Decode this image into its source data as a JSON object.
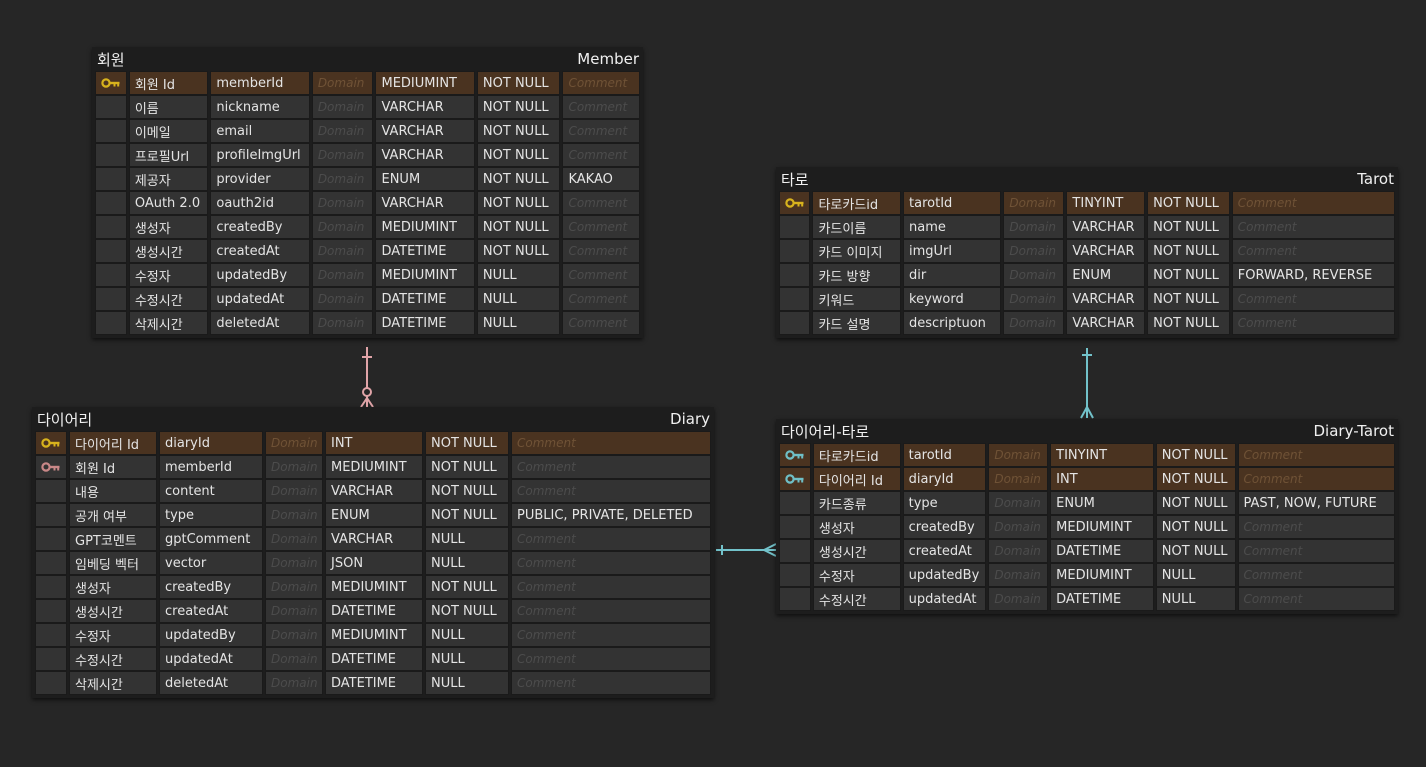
{
  "colors": {
    "pk": "#d8b31d",
    "fk": "#c98888",
    "fk_cyan": "#6fbfc6",
    "rel_pink": "#e0a4a8",
    "rel_cyan": "#72c2ca"
  },
  "placeholders": {
    "domain": "Domain",
    "comment": "Comment"
  },
  "member": {
    "title_ko": "회원",
    "title_en": "Member",
    "rows": [
      {
        "key": "pk",
        "ko": "회원 Id",
        "name": "memberId",
        "type": "MEDIUMINT",
        "nullable": "NOT NULL",
        "comment": ""
      },
      {
        "key": "",
        "ko": "이름",
        "name": "nickname",
        "type": "VARCHAR",
        "nullable": "NOT NULL",
        "comment": ""
      },
      {
        "key": "",
        "ko": "이메일",
        "name": "email",
        "type": "VARCHAR",
        "nullable": "NOT NULL",
        "comment": ""
      },
      {
        "key": "",
        "ko": "프로필Url",
        "name": "profileImgUrl",
        "type": "VARCHAR",
        "nullable": "NOT NULL",
        "comment": ""
      },
      {
        "key": "",
        "ko": "제공자",
        "name": "provider",
        "type": "ENUM",
        "nullable": "NOT NULL",
        "comment": "KAKAO"
      },
      {
        "key": "",
        "ko": "OAuth 2.0",
        "name": "oauth2id",
        "type": "VARCHAR",
        "nullable": "NOT NULL",
        "comment": ""
      },
      {
        "key": "",
        "ko": "생성자",
        "name": "createdBy",
        "type": "MEDIUMINT",
        "nullable": "NOT NULL",
        "comment": ""
      },
      {
        "key": "",
        "ko": "생성시간",
        "name": "createdAt",
        "type": "DATETIME",
        "nullable": "NOT NULL",
        "comment": ""
      },
      {
        "key": "",
        "ko": "수정자",
        "name": "updatedBy",
        "type": "MEDIUMINT",
        "nullable": "NULL",
        "comment": ""
      },
      {
        "key": "",
        "ko": "수정시간",
        "name": "updatedAt",
        "type": "DATETIME",
        "nullable": "NULL",
        "comment": ""
      },
      {
        "key": "",
        "ko": "삭제시간",
        "name": "deletedAt",
        "type": "DATETIME",
        "nullable": "NULL",
        "comment": ""
      }
    ]
  },
  "tarot": {
    "title_ko": "타로",
    "title_en": "Tarot",
    "rows": [
      {
        "key": "pk",
        "ko": "타로카드id",
        "name": "tarotId",
        "type": "TINYINT",
        "nullable": "NOT NULL",
        "comment": ""
      },
      {
        "key": "",
        "ko": "카드이름",
        "name": "name",
        "type": "VARCHAR",
        "nullable": "NOT NULL",
        "comment": ""
      },
      {
        "key": "",
        "ko": "카드 이미지",
        "name": "imgUrl",
        "type": "VARCHAR",
        "nullable": "NOT NULL",
        "comment": ""
      },
      {
        "key": "",
        "ko": "카드 방향",
        "name": "dir",
        "type": "ENUM",
        "nullable": "NOT NULL",
        "comment": "FORWARD, REVERSE"
      },
      {
        "key": "",
        "ko": "키워드",
        "name": "keyword",
        "type": "VARCHAR",
        "nullable": "NOT NULL",
        "comment": ""
      },
      {
        "key": "",
        "ko": "카드 설명",
        "name": "descriptuon",
        "type": "VARCHAR",
        "nullable": "NOT NULL",
        "comment": ""
      }
    ]
  },
  "diary": {
    "title_ko": "다이어리",
    "title_en": "Diary",
    "rows": [
      {
        "key": "pk",
        "ko": "다이어리 Id",
        "name": "diaryId",
        "type": "INT",
        "nullable": "NOT NULL",
        "comment": ""
      },
      {
        "key": "fk",
        "ko": "회원 Id",
        "name": "memberId",
        "type": "MEDIUMINT",
        "nullable": "NOT NULL",
        "comment": ""
      },
      {
        "key": "",
        "ko": "내용",
        "name": "content",
        "type": "VARCHAR",
        "nullable": "NOT NULL",
        "comment": ""
      },
      {
        "key": "",
        "ko": "공개 여부",
        "name": "type",
        "type": "ENUM",
        "nullable": "NOT NULL",
        "comment": "PUBLIC, PRIVATE, DELETED"
      },
      {
        "key": "",
        "ko": "GPT코멘트",
        "name": "gptComment",
        "type": "VARCHAR",
        "nullable": "NULL",
        "comment": ""
      },
      {
        "key": "",
        "ko": "임베딩 벡터",
        "name": "vector",
        "type": "JSON",
        "nullable": "NULL",
        "comment": ""
      },
      {
        "key": "",
        "ko": "생성자",
        "name": "createdBy",
        "type": "MEDIUMINT",
        "nullable": "NOT NULL",
        "comment": ""
      },
      {
        "key": "",
        "ko": "생성시간",
        "name": "createdAt",
        "type": "DATETIME",
        "nullable": "NOT NULL",
        "comment": ""
      },
      {
        "key": "",
        "ko": "수정자",
        "name": "updatedBy",
        "type": "MEDIUMINT",
        "nullable": "NULL",
        "comment": ""
      },
      {
        "key": "",
        "ko": "수정시간",
        "name": "updatedAt",
        "type": "DATETIME",
        "nullable": "NULL",
        "comment": ""
      },
      {
        "key": "",
        "ko": "삭제시간",
        "name": "deletedAt",
        "type": "DATETIME",
        "nullable": "NULL",
        "comment": ""
      }
    ]
  },
  "diary_tarot": {
    "title_ko": "다이어리-타로",
    "title_en": "Diary-Tarot",
    "rows": [
      {
        "key": "fkpk",
        "ko": "타로카드id",
        "name": "tarotId",
        "type": "TINYINT",
        "nullable": "NOT NULL",
        "comment": ""
      },
      {
        "key": "fkpk",
        "ko": "다이어리 Id",
        "name": "diaryId",
        "type": "INT",
        "nullable": "NOT NULL",
        "comment": ""
      },
      {
        "key": "",
        "ko": "카드종류",
        "name": "type",
        "type": "ENUM",
        "nullable": "NOT NULL",
        "comment": "PAST, NOW, FUTURE"
      },
      {
        "key": "",
        "ko": "생성자",
        "name": "createdBy",
        "type": "MEDIUMINT",
        "nullable": "NOT NULL",
        "comment": ""
      },
      {
        "key": "",
        "ko": "생성시간",
        "name": "createdAt",
        "type": "DATETIME",
        "nullable": "NOT NULL",
        "comment": ""
      },
      {
        "key": "",
        "ko": "수정자",
        "name": "updatedBy",
        "type": "MEDIUMINT",
        "nullable": "NULL",
        "comment": ""
      },
      {
        "key": "",
        "ko": "수정시간",
        "name": "updatedAt",
        "type": "DATETIME",
        "nullable": "NULL",
        "comment": ""
      }
    ]
  }
}
